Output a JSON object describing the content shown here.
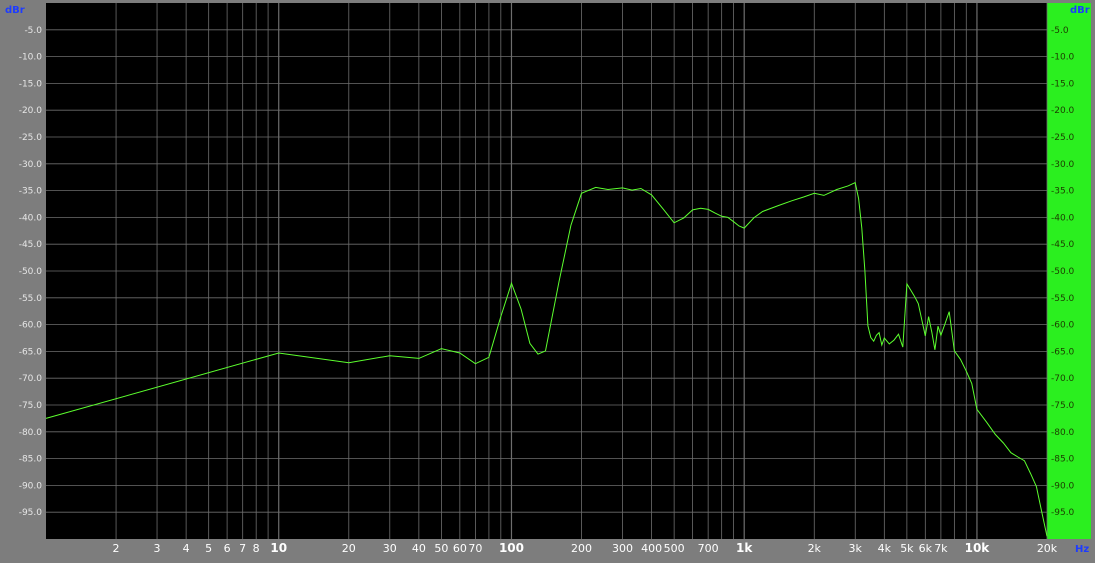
{
  "chart_data": {
    "type": "line",
    "xscale": "log",
    "xlim": [
      1,
      20000
    ],
    "ylim": [
      -100,
      0
    ],
    "grid": true,
    "ylabel": "dBr",
    "xlabel": "Hz",
    "y_ticks": [
      -5,
      -10,
      -15,
      -20,
      -25,
      -30,
      -35,
      -40,
      -45,
      -50,
      -55,
      -60,
      -65,
      -70,
      -75,
      -80,
      -85,
      -90,
      -95
    ],
    "y_tick_labels": [
      "-5.0",
      "-10.0",
      "-15.0",
      "-20.0",
      "-25.0",
      "-30.0",
      "-35.0",
      "-40.0",
      "-45.0",
      "-50.0",
      "-55.0",
      "-60.0",
      "-65.0",
      "-70.0",
      "-75.0",
      "-80.0",
      "-85.0",
      "-90.0",
      "-95.0"
    ],
    "x_tick_labels": [
      {
        "v": 2,
        "label": "2"
      },
      {
        "v": 3,
        "label": "3"
      },
      {
        "v": 4,
        "label": "4"
      },
      {
        "v": 5,
        "label": "5"
      },
      {
        "v": 6,
        "label": "6"
      },
      {
        "v": 7,
        "label": "7"
      },
      {
        "v": 8,
        "label": "8"
      },
      {
        "v": 10,
        "label": "10",
        "major": true
      },
      {
        "v": 20,
        "label": "20"
      },
      {
        "v": 30,
        "label": "30"
      },
      {
        "v": 40,
        "label": "40"
      },
      {
        "v": 50,
        "label": "50"
      },
      {
        "v": 60,
        "label": "60"
      },
      {
        "v": 70,
        "label": "70"
      },
      {
        "v": 100,
        "label": "100",
        "major": true
      },
      {
        "v": 200,
        "label": "200"
      },
      {
        "v": 300,
        "label": "300"
      },
      {
        "v": 400,
        "label": "400"
      },
      {
        "v": 500,
        "label": "500"
      },
      {
        "v": 700,
        "label": "700"
      },
      {
        "v": 1000,
        "label": "1k",
        "major": true
      },
      {
        "v": 2000,
        "label": "2k"
      },
      {
        "v": 3000,
        "label": "3k"
      },
      {
        "v": 4000,
        "label": "4k"
      },
      {
        "v": 5000,
        "label": "5k"
      },
      {
        "v": 6000,
        "label": "6k"
      },
      {
        "v": 7000,
        "label": "7k"
      },
      {
        "v": 10000,
        "label": "10k",
        "major": true
      },
      {
        "v": 20000,
        "label": "20k"
      }
    ],
    "colors": {
      "line": "#5cff2e",
      "background": "#000000",
      "grid": "#6e6e6e",
      "frame": "#7d7d7d",
      "right_axis": "#2bef1f"
    },
    "series": [
      {
        "x": [
          1,
          10,
          20,
          30,
          40,
          50,
          60,
          70,
          80,
          90,
          100,
          110,
          120,
          130,
          140,
          160,
          180,
          200,
          230,
          260,
          300,
          330,
          360,
          400,
          450,
          500,
          550,
          600,
          650,
          700,
          750,
          800,
          850,
          900,
          950,
          1000,
          1100,
          1200,
          1400,
          1600,
          1800,
          2000,
          2200,
          2500,
          2800,
          3000,
          3100,
          3200,
          3300,
          3400,
          3500,
          3600,
          3700,
          3800,
          3900,
          4000,
          4200,
          4400,
          4600,
          4800,
          5000,
          5200,
          5400,
          5600,
          5800,
          6000,
          6200,
          6400,
          6600,
          6800,
          7000,
          7300,
          7600,
          8000,
          8500,
          9000,
          9500,
          10000,
          11000,
          12000,
          13000,
          14000,
          15000,
          16000,
          17000,
          18000,
          19000,
          20000
        ],
        "y": [
          -77.5,
          -65.3,
          -67.1,
          -65.8,
          -66.3,
          -64.5,
          -65.3,
          -67.3,
          -66.1,
          -58.5,
          -52.3,
          -57.1,
          -63.5,
          -65.5,
          -64.9,
          -52.0,
          -41.5,
          -35.5,
          -34.4,
          -34.8,
          -34.5,
          -34.9,
          -34.6,
          -35.8,
          -38.5,
          -41.0,
          -40.1,
          -38.6,
          -38.3,
          -38.5,
          -39.2,
          -39.8,
          -40.0,
          -40.8,
          -41.6,
          -42.0,
          -40.1,
          -38.9,
          -37.8,
          -36.9,
          -36.2,
          -35.5,
          -35.9,
          -34.8,
          -34.1,
          -33.5,
          -36.5,
          -42.0,
          -50.0,
          -60.2,
          -62.4,
          -63.1,
          -62.0,
          -61.5,
          -63.8,
          -62.5,
          -63.6,
          -62.9,
          -61.8,
          -64.2,
          -52.4,
          -53.6,
          -54.8,
          -56.1,
          -59.2,
          -62.1,
          -58.5,
          -61.4,
          -64.7,
          -60.3,
          -62.0,
          -59.8,
          -57.6,
          -64.9,
          -66.5,
          -68.7,
          -71.0,
          -75.8,
          -78.2,
          -80.5,
          -82.1,
          -83.9,
          -84.7,
          -85.4,
          -87.8,
          -90.2,
          -95.0,
          -99.5
        ]
      }
    ]
  }
}
